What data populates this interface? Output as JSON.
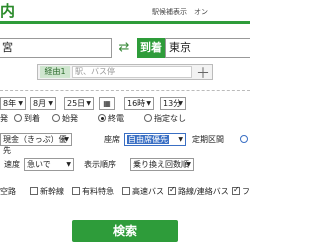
{
  "header": {
    "title": "内",
    "links": "駅候補表示　オン"
  },
  "from": {
    "value": "宮"
  },
  "to": {
    "label": "到着",
    "value": "東京"
  },
  "via": {
    "label": "経由1",
    "placeholder": "駅、バス停"
  },
  "datetime": {
    "year": "8年",
    "month": "8月",
    "day": "25日",
    "hour": "16時",
    "minute": "13分"
  },
  "time_type": {
    "options": [
      "発",
      "到着",
      "始発",
      "終電",
      "指定なし"
    ],
    "selected": "終電"
  },
  "fare": {
    "value": "現金（きっぷ）優先"
  },
  "seat": {
    "label": "座席",
    "value": "自由席優先"
  },
  "commuter": {
    "label": "定期区間"
  },
  "speed": {
    "label": "速度",
    "value": "急いで"
  },
  "order": {
    "label": "表示順序",
    "value": "乗り換え回数順"
  },
  "transport": [
    {
      "label": "空路",
      "checked": true
    },
    {
      "label": "新幹線",
      "checked": false
    },
    {
      "label": "有料特急",
      "checked": false
    },
    {
      "label": "高速バス",
      "checked": false
    },
    {
      "label": "路線/連絡バス",
      "checked": true
    },
    {
      "label": "フ",
      "checked": true
    }
  ],
  "search_button": "検索",
  "colors": {
    "accent": "#2e9c3a",
    "seat_highlight": "#3a6fc4"
  }
}
